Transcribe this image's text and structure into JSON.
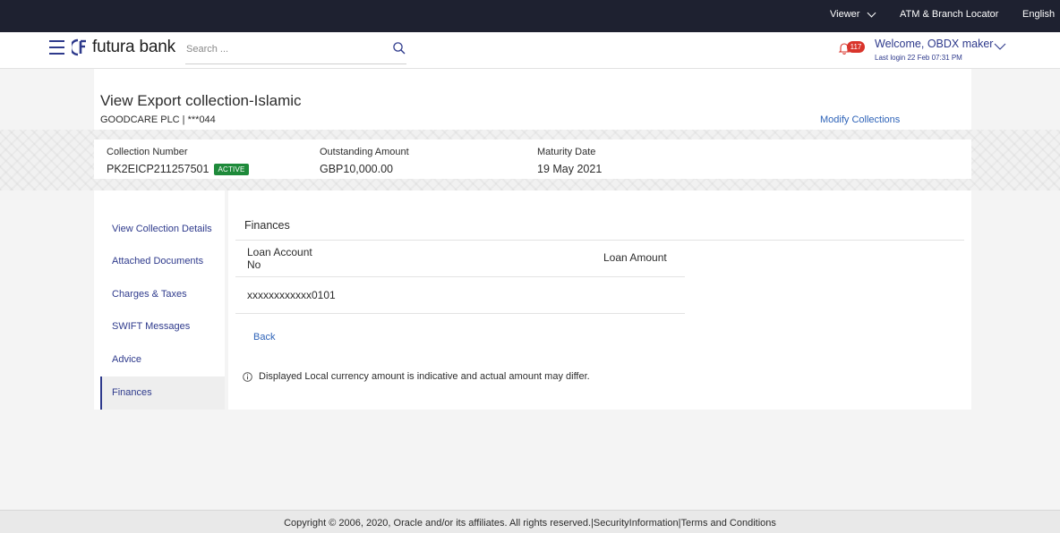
{
  "topbar": {
    "viewer": "Viewer",
    "atm": "ATM & Branch Locator",
    "language": "English"
  },
  "header": {
    "brand": "futura bank",
    "search_placeholder": "Search ...",
    "notification_count": "117",
    "welcome": "Welcome, OBDX maker",
    "last_login": "Last login 22 Feb 07:31 PM"
  },
  "page": {
    "title": "View Export collection-Islamic",
    "subtitle": "GOODCARE PLC | ***044",
    "modify_link": "Modify Collections"
  },
  "summary": {
    "collection_number_label": "Collection Number",
    "collection_number": "PK2EICP211257501",
    "status": "ACTIVE",
    "outstanding_label": "Outstanding Amount",
    "outstanding": "GBP10,000.00",
    "maturity_label": "Maturity Date",
    "maturity": "19 May 2021"
  },
  "sidebar": {
    "items": [
      {
        "label": "View Collection Details"
      },
      {
        "label": "Attached Documents"
      },
      {
        "label": "Charges & Taxes"
      },
      {
        "label": "SWIFT Messages"
      },
      {
        "label": "Advice"
      },
      {
        "label": "Finances"
      }
    ],
    "active": "Finances"
  },
  "finances": {
    "title": "Finances",
    "col_account_line1": "Loan Account",
    "col_account_line2": "No",
    "col_amount": "Loan Amount",
    "rows": [
      {
        "account": "xxxxxxxxxxxx0101",
        "amount": ""
      }
    ],
    "back": "Back",
    "note": "Displayed Local currency amount is indicative and actual amount may differ."
  },
  "footer": {
    "text": "Copyright © 2006, 2020, Oracle and/or its affiliates. All rights reserved.|SecurityInformation|Terms and Conditions"
  },
  "colors": {
    "topbar": "#1e2130",
    "accent": "#2e3a8c",
    "link": "#2e63b8",
    "status_active": "#1e8a3a",
    "badge": "#d9342b"
  }
}
